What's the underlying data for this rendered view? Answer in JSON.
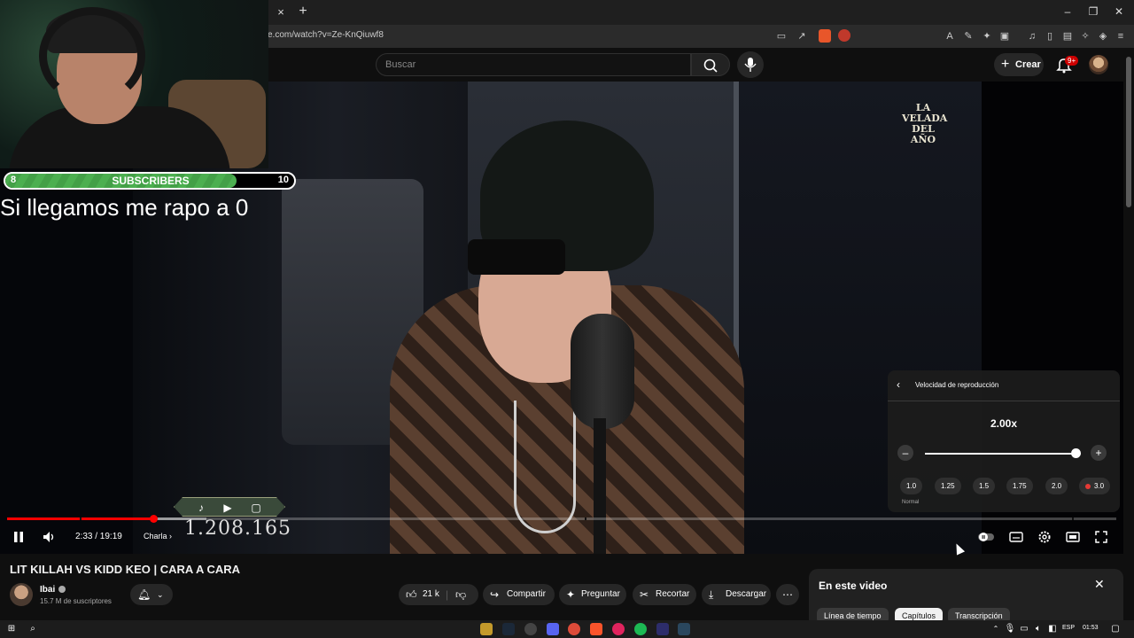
{
  "browser": {
    "tab_close": "×",
    "tab_new": "+",
    "url": "e.com/watch?v=Ze-KnQiuwf8",
    "brave_badge": "",
    "ext_badge": "1",
    "window_controls": [
      "–",
      "❐",
      "✕"
    ]
  },
  "header": {
    "search_placeholder": "Buscar",
    "create_label": "Crear",
    "notifications_badge": "9+"
  },
  "video": {
    "brand_logo": "LA VELADA DEL AÑO",
    "current_time": "2:33",
    "duration": "19:19",
    "time_display": "2:33 / 19:19",
    "chapter": "Charla",
    "progress_fraction": 0.132,
    "loaded_fraction": 0.18
  },
  "overlay": {
    "subscriber_goal": {
      "min": "8",
      "label": "SUBSCRIBERS",
      "max": "10",
      "fill_fraction": 0.8
    },
    "goal_text": "Si llegamos me rapo a 0",
    "social_count": "1.208.165"
  },
  "speed_panel": {
    "title": "Velocidad de reproducción",
    "value": "2.00x",
    "slider_fraction": 1.0,
    "presets": [
      "1.0",
      "1.25",
      "1.5",
      "1.75",
      "2.0",
      "3.0"
    ],
    "normal_label": "Normal"
  },
  "video_info": {
    "title": "LIT KILLAH VS KIDD KEO | CARA A CARA",
    "channel_name": "Ibai",
    "subscribers": "15.7 M de suscriptores",
    "likes": "21 k",
    "share_label": "Compartir",
    "ask_label": "Preguntar",
    "clip_label": "Recortar",
    "download_label": "Descargar"
  },
  "chapters_panel": {
    "title": "En este video",
    "tabs": [
      "Línea de tiempo",
      "Capítulos",
      "Transcripción"
    ],
    "active_tab": "Capítulos"
  },
  "taskbar": {
    "language": "ESP",
    "clock": "01:53"
  }
}
